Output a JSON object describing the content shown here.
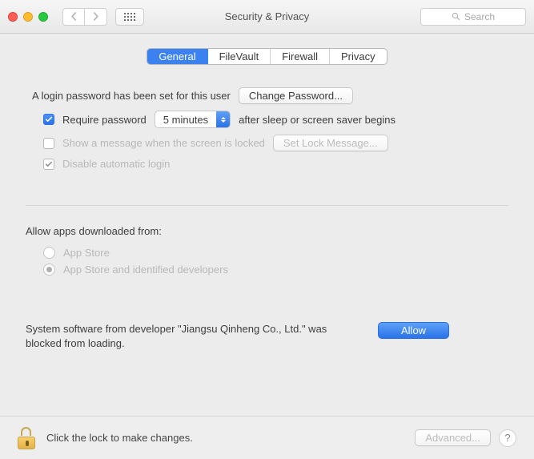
{
  "window": {
    "title": "Security & Privacy",
    "search_placeholder": "Search"
  },
  "tabs": {
    "general": "General",
    "filevault": "FileVault",
    "firewall": "Firewall",
    "privacy": "Privacy"
  },
  "login": {
    "intro": "A login password has been set for this user",
    "change_password_btn": "Change Password...",
    "require_password_label": "Require password",
    "require_password_delay": "5 minutes",
    "require_password_suffix": "after sleep or screen saver begins",
    "show_message_label": "Show a message when the screen is locked",
    "set_lock_message_btn": "Set Lock Message...",
    "disable_auto_login_label": "Disable automatic login"
  },
  "download": {
    "heading": "Allow apps downloaded from:",
    "option_appstore": "App Store",
    "option_appstore_dev": "App Store and identified developers"
  },
  "blocked": {
    "message": "System software from developer \"Jiangsu Qinheng Co., Ltd.\" was blocked from loading.",
    "allow_btn": "Allow"
  },
  "footer": {
    "lock_text": "Click the lock to make changes.",
    "advanced_btn": "Advanced...",
    "help": "?"
  }
}
